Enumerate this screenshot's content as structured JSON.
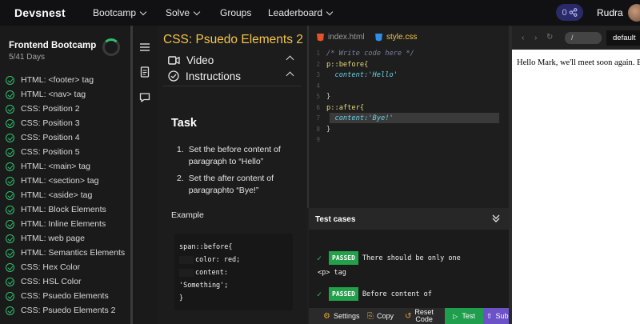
{
  "topbar": {
    "brand": "Devsnest",
    "nav": [
      {
        "label": "Bootcamp",
        "has_menu": true
      },
      {
        "label": "Solve",
        "has_menu": true
      },
      {
        "label": "Groups",
        "has_menu": false
      },
      {
        "label": "Leaderboard",
        "has_menu": true
      }
    ],
    "share_count": "0",
    "user_name": "Rudra"
  },
  "sidebar": {
    "course_title": "Frontend Bootcamp",
    "course_days": "5/41 Days",
    "lessons": [
      "HTML: <footer> tag",
      "HTML: <nav> tag",
      "CSS: Position 2",
      "CSS: Position 3",
      "CSS: Position 4",
      "CSS: Position 5",
      "HTML: <main> tag",
      "HTML: <section> tag",
      "HTML: <aside> tag",
      "HTML: Block Elements",
      "HTML: Inline Elements",
      "HTML: web page",
      "HTML: Semantics Elements",
      "CSS: Hex Color",
      "CSS: HSL Color",
      "CSS: Psuedo Elements",
      "CSS: Psuedo Elements 2"
    ]
  },
  "lesson": {
    "title": "CSS: Psuedo Elements 2",
    "video_label": "Video",
    "instructions_label": "Instructions",
    "task_heading": "Task",
    "steps": [
      {
        "num": "1.",
        "text_before": "Set the before content of paragraph to ",
        "quoted": "“Hello”"
      },
      {
        "num": "2.",
        "text_before": "Set the after content of paragraphto ",
        "quoted": "“Bye!”"
      }
    ],
    "example_label": "Example",
    "example_code": [
      "span::before{",
      "color: red;",
      "content:",
      "'Something';",
      "}"
    ]
  },
  "editor": {
    "tabs": [
      {
        "label": "index.html",
        "active": false
      },
      {
        "label": "style.css",
        "active": true
      }
    ],
    "line_numbers": [
      "1",
      "2",
      "3",
      "4",
      "5",
      "6",
      "7",
      "8",
      "9"
    ],
    "lines": [
      "/* Write code here */",
      "p::before{",
      "content:'Hello'",
      "",
      "}",
      "p::after{",
      "content:'Bye!'",
      "}",
      ""
    ]
  },
  "tests": {
    "title": "Test cases",
    "badge": "PASSED",
    "items": [
      {
        "line1": "There should be only one",
        "line2": "<p> tag"
      },
      {
        "line1": "Before content of",
        "line2": ""
      }
    ]
  },
  "toolbar": {
    "settings": "Settings",
    "copy": "Copy",
    "reset_line1": "Reset",
    "reset_line2": "Code",
    "test": "Test",
    "submit": "Submit"
  },
  "preview": {
    "url": "/",
    "device": "default",
    "output": "Hello Mark, we'll meet soon again. Bye!"
  },
  "colors": {
    "accent_yellow": "#f3c44b",
    "success_green": "#2fbf6c",
    "passed_badge": "#22a04a",
    "submit_purple": "#6b52c9"
  }
}
